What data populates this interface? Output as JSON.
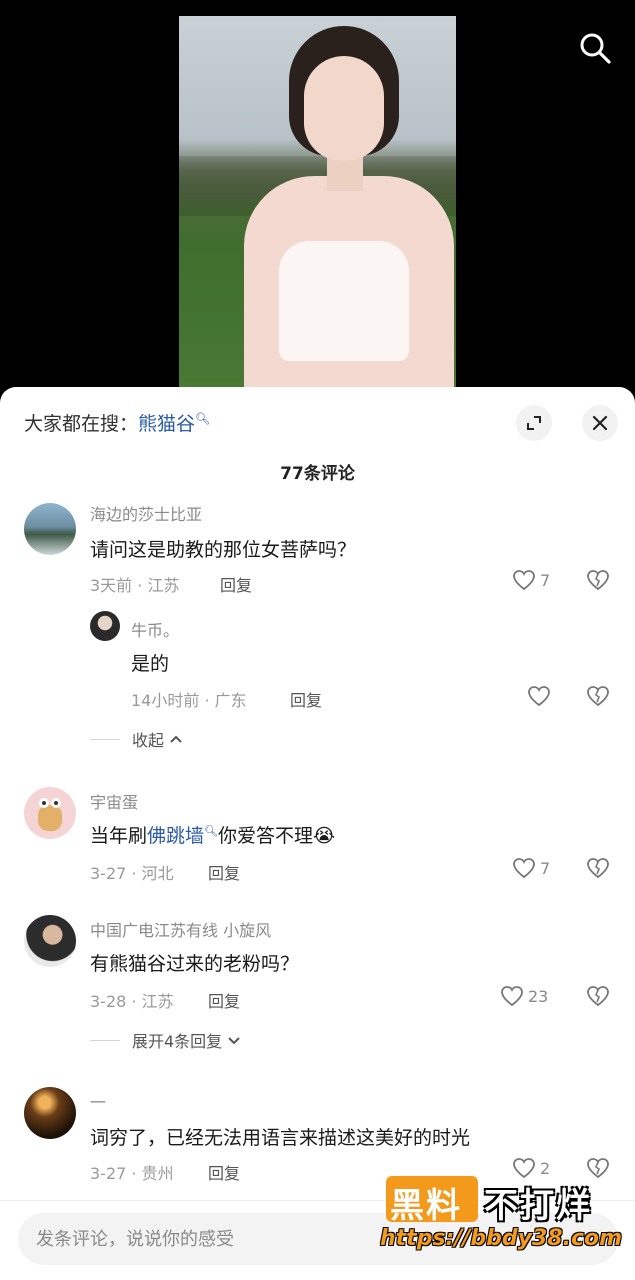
{
  "hot_search": {
    "prefix": "大家都在搜：",
    "keyword": "熊猫谷"
  },
  "comment_count": "77条评论",
  "comments": [
    {
      "user": "海边的莎士比亚",
      "text": "请问这是助教的那位女菩萨吗？",
      "meta": "3天前 · 江苏",
      "reply_label": "回复",
      "likes": "7",
      "replies": [
        {
          "user": "牛币。",
          "text": "是的",
          "meta": "14小时前 · 广东",
          "reply_label": "回复"
        }
      ],
      "fold_label": "收起"
    },
    {
      "user": "宇宙蛋",
      "text_before": "当年刷",
      "keyword": "佛跳墙",
      "text_after": "你爱答不理",
      "emoji": "😭",
      "meta": "3-27 · 河北",
      "reply_label": "回复",
      "likes": "7"
    },
    {
      "user": "中国广电江苏有线 小旋风",
      "text": "有熊猫谷过来的老粉吗？",
      "meta": "3-28 · 江苏",
      "reply_label": "回复",
      "likes": "23",
      "expand_label": "展开4条回复"
    },
    {
      "user": "一",
      "text": "词穷了，已经无法用语言来描述这美好的时光",
      "meta": "3-27 · 贵州",
      "reply_label": "回复",
      "likes": "2"
    }
  ],
  "input": {
    "placeholder": "发条评论，说说你的感受"
  },
  "watermark": {
    "part_a": "黑料",
    "part_b": "不打烊",
    "url": "https://bbdy38.com"
  },
  "icons": {
    "search": "search-icon",
    "expand": "expand-icon",
    "close": "close-icon",
    "like": "heart-icon",
    "dislike": "broken-heart-icon",
    "fold": "chevron-up-icon",
    "unfold": "chevron-down-icon"
  },
  "colors": {
    "keyword": "#2b5aa8",
    "watermark_orange": "#f39a1c"
  }
}
